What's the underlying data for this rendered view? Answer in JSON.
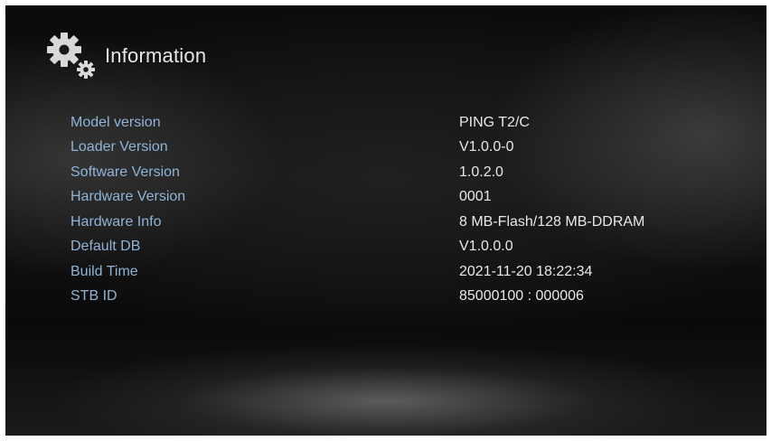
{
  "header": {
    "title": "Information",
    "icon": "gear-icon"
  },
  "info": [
    {
      "label": "Model version",
      "value": "PING T2/C"
    },
    {
      "label": "Loader Version",
      "value": "V1.0.0-0"
    },
    {
      "label": "Software Version",
      "value": "1.0.2.0"
    },
    {
      "label": "Hardware Version",
      "value": "0001"
    },
    {
      "label": "Hardware Info",
      "value": "8 MB-Flash/128 MB-DDRAM"
    },
    {
      "label": "Default DB",
      "value": "V1.0.0.0"
    },
    {
      "label": "Build Time",
      "value": "2021-11-20 18:22:34"
    },
    {
      "label": "STB ID",
      "value": "85000100 : 000006"
    }
  ],
  "colors": {
    "label": "#8fb4d8",
    "value": "#e8e8e8",
    "title": "#e6e6e6"
  }
}
